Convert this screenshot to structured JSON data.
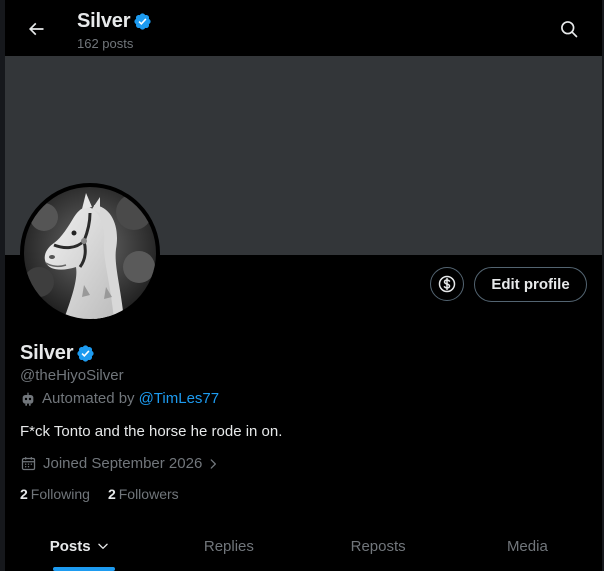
{
  "header": {
    "title": "Silver",
    "post_count": "162 posts"
  },
  "profile": {
    "name": "Silver",
    "handle": "@theHiyoSilver",
    "automated_prefix": "Automated by",
    "automated_by": "@TimLes77",
    "bio": "F*ck Tonto and the horse he rode in on.",
    "joined": "Joined September 2026",
    "following_count": "2",
    "following_label": "Following",
    "followers_count": "2",
    "followers_label": "Followers"
  },
  "actions": {
    "edit_profile_label": "Edit profile"
  },
  "tabs": [
    {
      "label": "Posts"
    },
    {
      "label": "Replies"
    },
    {
      "label": "Reposts"
    },
    {
      "label": "Media"
    }
  ],
  "active_tab": "Posts",
  "colors": {
    "accent": "#1d9bf0",
    "text_primary": "#e7e9ea",
    "text_secondary": "#71767b",
    "banner": "#333639",
    "background": "#000000"
  },
  "icons": {
    "back": "arrow-left-icon",
    "search": "search-icon",
    "verified": "verified-badge-icon",
    "money": "dollar-icon",
    "bot": "bot-icon",
    "calendar": "calendar-icon",
    "chevron": "chevron-right-icon",
    "tab_chevron": "chevron-down-icon"
  }
}
